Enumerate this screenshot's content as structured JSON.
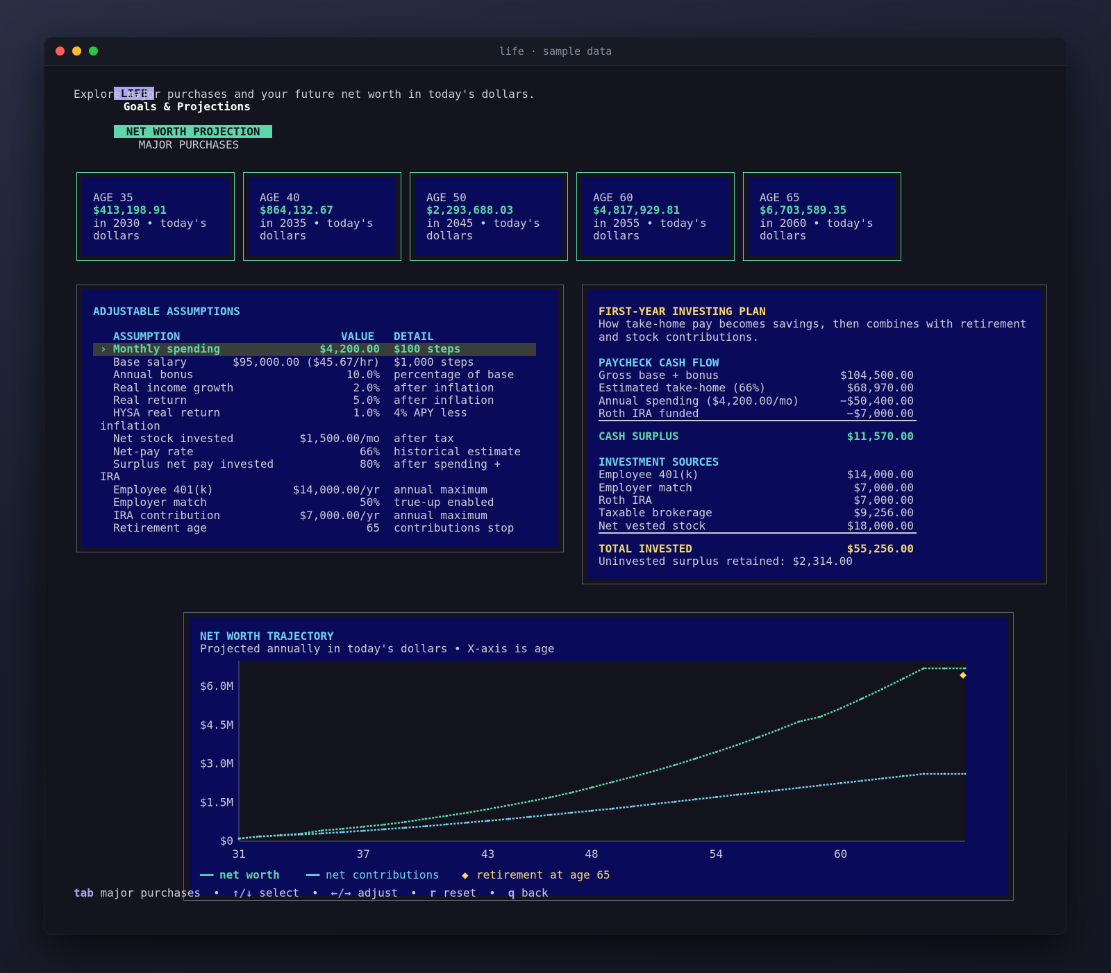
{
  "window": {
    "title": "life · sample data"
  },
  "header": {
    "tag": "LIFE",
    "title": "Goals & Projections",
    "subtitle": "Explore major purchases and your future net worth in today's dollars."
  },
  "tabs": [
    {
      "label": "NET WORTH PROJECTION",
      "active": true
    },
    {
      "label": "MAJOR PURCHASES",
      "active": false
    }
  ],
  "milestones": [
    {
      "age": "AGE 35",
      "amount": "$413,198.91",
      "note": "in 2030 • today's dollars"
    },
    {
      "age": "AGE 40",
      "amount": "$864,132.67",
      "note": "in 2035 • today's dollars"
    },
    {
      "age": "AGE 50",
      "amount": "$2,293,688.03",
      "note": "in 2045 • today's dollars"
    },
    {
      "age": "AGE 60",
      "amount": "$4,817,929.81",
      "note": "in 2055 • today's dollars"
    },
    {
      "age": "AGE 65",
      "amount": "$6,703,589.35",
      "note": "in 2060 • today's dollars"
    }
  ],
  "assumptions": {
    "title": "ADJUSTABLE ASSUMPTIONS",
    "col_assumption": "ASSUMPTION",
    "col_value": "VALUE",
    "col_detail": "DETAIL",
    "selected_marker": "›",
    "rows": [
      {
        "name": "Monthly spending",
        "value": "$4,200.00",
        "detail": "$100 steps"
      },
      {
        "name": "Base salary",
        "value": "$95,000.00 ($45.67/hr)",
        "detail": "$1,000 steps"
      },
      {
        "name": "Annual bonus",
        "value": "10.0%",
        "detail": "percentage of base"
      },
      {
        "name": "Real income growth",
        "value": "2.0%",
        "detail": "after inflation"
      },
      {
        "name": "Real return",
        "value": "5.0%",
        "detail": "after inflation"
      },
      {
        "name": "HYSA real return",
        "value": "1.0%",
        "detail": "4% APY less"
      },
      {
        "name": "inflation",
        "value": "",
        "detail": ""
      },
      {
        "name": "Net stock invested",
        "value": "$1,500.00/mo",
        "detail": "after tax"
      },
      {
        "name": "Net-pay rate",
        "value": "66%",
        "detail": "historical estimate"
      },
      {
        "name": "Surplus net pay invested",
        "value": "80%",
        "detail": "after spending +"
      },
      {
        "name": "IRA",
        "value": "",
        "detail": ""
      },
      {
        "name": "Employee 401(k)",
        "value": "$14,000.00/yr",
        "detail": "annual maximum"
      },
      {
        "name": "Employer match",
        "value": "50%",
        "detail": "true-up enabled"
      },
      {
        "name": "IRA contribution",
        "value": "$7,000.00/yr",
        "detail": "annual maximum"
      },
      {
        "name": "Retirement age",
        "value": "65",
        "detail": "contributions stop"
      }
    ]
  },
  "plan": {
    "title": "FIRST-YEAR INVESTING PLAN",
    "desc_1": "How take-home pay becomes savings, then combines with retirement",
    "desc_2": "and stock contributions.",
    "cashflow_title": "PAYCHECK CASH FLOW",
    "cashflow": [
      {
        "label": "Gross base + bonus",
        "value": "$104,500.00"
      },
      {
        "label": "Estimated take-home (66%)",
        "value": "$68,970.00"
      },
      {
        "label": "Annual spending ($4,200.00/mo)",
        "value": "−$50,400.00"
      },
      {
        "label": "Roth IRA funded",
        "value": "−$7,000.00"
      }
    ],
    "surplus_label": "CASH SURPLUS",
    "surplus_value": "$11,570.00",
    "sources_title": "INVESTMENT SOURCES",
    "sources": [
      {
        "label": "Employee 401(k)",
        "value": "$14,000.00"
      },
      {
        "label": "Employer match",
        "value": "$7,000.00"
      },
      {
        "label": "Roth IRA",
        "value": "$7,000.00"
      },
      {
        "label": "Taxable brokerage",
        "value": "$9,256.00"
      },
      {
        "label": "Net vested stock",
        "value": "$18,000.00"
      }
    ],
    "total_label": "TOTAL INVESTED",
    "total_value": "$55,256.00",
    "uninvested": "Uninvested surplus retained: $2,314.00"
  },
  "chart_data": {
    "type": "line",
    "title": "NET WORTH TRAJECTORY",
    "subtitle": "Projected annually in today's dollars • X-axis is age",
    "xlabel": "",
    "ylabel": "",
    "xlim": [
      31,
      66
    ],
    "ylim": [
      0,
      7000000
    ],
    "x_ticks": [
      31,
      37,
      43,
      48,
      54,
      60
    ],
    "y_ticks": [
      {
        "v": 0,
        "label": "$0"
      },
      {
        "v": 1500000,
        "label": "$1.5M"
      },
      {
        "v": 3000000,
        "label": "$3.0M"
      },
      {
        "v": 4500000,
        "label": "$4.5M"
      },
      {
        "v": 6000000,
        "label": "$6.0M"
      }
    ],
    "x": [
      31,
      32,
      33,
      34,
      35,
      36,
      37,
      38,
      39,
      40,
      41,
      42,
      43,
      44,
      45,
      46,
      47,
      48,
      49,
      50,
      51,
      52,
      53,
      54,
      55,
      56,
      57,
      58,
      59,
      60,
      61,
      62,
      63,
      64,
      65,
      66
    ],
    "series": [
      {
        "name": "net worth",
        "color": "#5fd6a8",
        "values": [
          100000,
          180000,
          230000,
          290000,
          413199,
          480000,
          560000,
          640000,
          740000,
          864133,
          980000,
          1100000,
          1240000,
          1390000,
          1540000,
          1700000,
          1880000,
          2080000,
          2293688,
          2500000,
          2720000,
          2950000,
          3200000,
          3460000,
          3730000,
          4020000,
          4320000,
          4640000,
          4817930,
          5150000,
          5520000,
          5900000,
          6300000,
          6703589,
          6703589,
          6703589
        ]
      },
      {
        "name": "net contributions",
        "color": "#6fd0f0",
        "values": [
          100000,
          180000,
          220000,
          260000,
          300000,
          350000,
          400000,
          460000,
          520000,
          580000,
          650000,
          720000,
          790000,
          860000,
          940000,
          1020000,
          1100000,
          1180000,
          1260000,
          1350000,
          1440000,
          1530000,
          1620000,
          1710000,
          1800000,
          1890000,
          1980000,
          2070000,
          2160000,
          2250000,
          2340000,
          2430000,
          2520000,
          2610000,
          2610000,
          2610000
        ]
      }
    ],
    "marker": {
      "label": "retirement at age 65",
      "x": 65,
      "y": 6703589,
      "color": "#f5d76e"
    }
  },
  "legend": {
    "net_worth": "net worth",
    "net_contributions": "net contributions",
    "retirement": "retirement at age 65"
  },
  "footer": [
    {
      "key": "tab",
      "label": "major purchases"
    },
    {
      "key": "↑/↓",
      "label": "select"
    },
    {
      "key": "←/→",
      "label": "adjust"
    },
    {
      "key": "r",
      "label": "reset"
    },
    {
      "key": "q",
      "label": "back"
    }
  ],
  "footer_sep": "•"
}
